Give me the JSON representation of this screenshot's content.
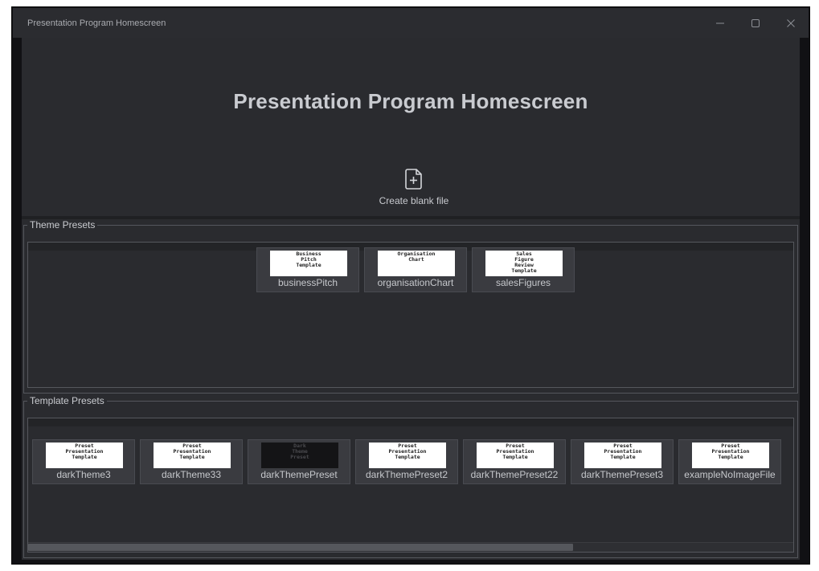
{
  "window": {
    "title": "Presentation Program Homescreen",
    "controls": [
      "minimize-icon",
      "maximize-icon",
      "close-icon"
    ]
  },
  "header": {
    "title": "Presentation Program Homescreen",
    "create_blank_label": "Create blank file",
    "create_blank_icon": "new-file-plus-icon"
  },
  "theme_presets": {
    "label": "Theme Presets",
    "items": [
      {
        "label": "businessPitch",
        "thumb_text": [
          "Business",
          "Pitch",
          "Template"
        ]
      },
      {
        "label": "organisationChart",
        "thumb_text": [
          "Organisation",
          "Chart"
        ]
      },
      {
        "label": "salesFigures",
        "thumb_text": [
          "Sales",
          "Figure",
          "Review",
          "Template"
        ]
      }
    ]
  },
  "template_presets": {
    "label": "Template Presets",
    "items": [
      {
        "label": "darkTheme3",
        "thumb_text": [
          "Preset",
          "Presentation",
          "Template"
        ],
        "dark": false
      },
      {
        "label": "darkTheme33",
        "thumb_text": [
          "Preset",
          "Presentation",
          "Template"
        ],
        "dark": false
      },
      {
        "label": "darkThemePreset",
        "thumb_text": [
          "Dark",
          "Theme",
          "Preset"
        ],
        "dark": true
      },
      {
        "label": "darkThemePreset2",
        "thumb_text": [
          "Preset",
          "Presentation",
          "Template"
        ],
        "dark": false
      },
      {
        "label": "darkThemePreset22",
        "thumb_text": [
          "Preset",
          "Presentation",
          "Template"
        ],
        "dark": false
      },
      {
        "label": "darkThemePreset3",
        "thumb_text": [
          "Preset",
          "Presentation",
          "Template"
        ],
        "dark": false
      },
      {
        "label": "exampleNoImageFile",
        "thumb_text": [
          "Preset",
          "Presentation",
          "Template"
        ],
        "dark": false
      }
    ]
  },
  "colors": {
    "window_bg": "#2a2b2f",
    "titlebar_bg": "#2b2c30",
    "card_bg": "#3a3b40",
    "text": "#c9cbd0"
  }
}
